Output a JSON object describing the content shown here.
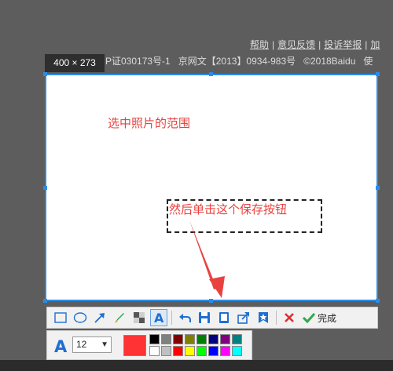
{
  "background": {
    "footer_links": [
      "帮助",
      "意见反馈",
      "投诉举报",
      "加"
    ],
    "icp_text": "P证030173号-1",
    "netculture_text": "京网文【2013】0934-983号",
    "copyright_text": "©2018Baidu",
    "trailing_text": "使"
  },
  "selection": {
    "dimension_label": "400 × 273"
  },
  "annotations": {
    "range_text": "选中照片的范围",
    "save_hint_text": "然后单击这个保存按钮"
  },
  "toolbar": {
    "tools": [
      "rectangle-icon",
      "ellipse-icon",
      "arrow-icon",
      "brush-icon",
      "mosaic-icon",
      "text-icon",
      "undo-icon",
      "save-icon",
      "copy-icon",
      "share-icon",
      "pin-icon",
      "close-icon",
      "check-icon"
    ],
    "done_label": "完成"
  },
  "text_options": {
    "font_size_value": "12",
    "selected_color": "#ff3333",
    "palette_row1": [
      "#000000",
      "#808080",
      "#800000",
      "#808000",
      "#008000",
      "#000080",
      "#800080",
      "#008080"
    ],
    "palette_row2": [
      "#ffffff",
      "#c0c0c0",
      "#ff0000",
      "#ffff00",
      "#00ff00",
      "#0000ff",
      "#ff00ff",
      "#00ffff"
    ]
  },
  "colors": {
    "accent": "#2a8ce8",
    "annotation_red": "#e8423f",
    "done_green": "#2fa84f",
    "cancel_red": "#e03030"
  }
}
